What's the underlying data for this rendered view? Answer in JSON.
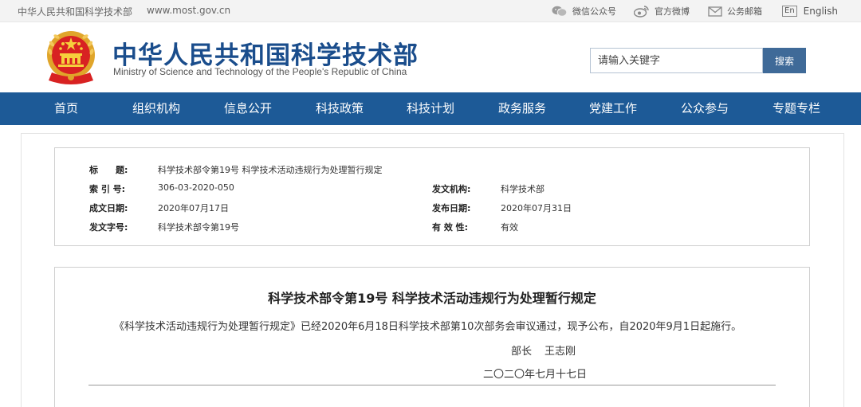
{
  "topbar": {
    "site_name": "中华人民共和国科学技术部",
    "site_url": "www.most.gov.cn",
    "links": {
      "wechat": "微信公众号",
      "weibo": "官方微博",
      "mail": "公务邮箱",
      "english_box": "En",
      "english": "English"
    }
  },
  "header": {
    "title_cn": "中华人民共和国科学技术部",
    "title_en": "Ministry of Science and Technology of the People's Republic of China",
    "search_placeholder": "请输入关键字",
    "search_button": "搜索"
  },
  "nav": {
    "items": [
      "首页",
      "组织机构",
      "信息公开",
      "科技政策",
      "科技计划",
      "政务服务",
      "党建工作",
      "公众参与",
      "专题专栏"
    ]
  },
  "meta": {
    "title_label": "标　　题:",
    "title_value": "科学技术部令第19号 科学技术活动违规行为处理暂行规定",
    "index_label": "索 引 号:",
    "index_value": "306-03-2020-050",
    "issuer_label": "发文机构:",
    "issuer_value": "科学技术部",
    "created_label": "成文日期:",
    "created_value": "2020年07月17日",
    "published_label": "发布日期:",
    "published_value": "2020年07月31日",
    "docno_label": "发文字号:",
    "docno_value": "科学技术部令第19号",
    "validity_label": "有 效 性:",
    "validity_value": "有效"
  },
  "document": {
    "title": "科学技术部令第19号 科学技术活动违规行为处理暂行规定",
    "body": "《科学技术活动违规行为处理暂行规定》已经2020年6月18日科学技术部第10次部务会审议通过，现予公布，自2020年9月1日起施行。",
    "sign_title": "部长",
    "sign_name": "王志刚",
    "date": "二〇二〇年七月十七日"
  },
  "colors": {
    "brand_blue": "#1d5a97",
    "title_blue": "#1a4d8c",
    "search_button": "#3f6a98"
  }
}
